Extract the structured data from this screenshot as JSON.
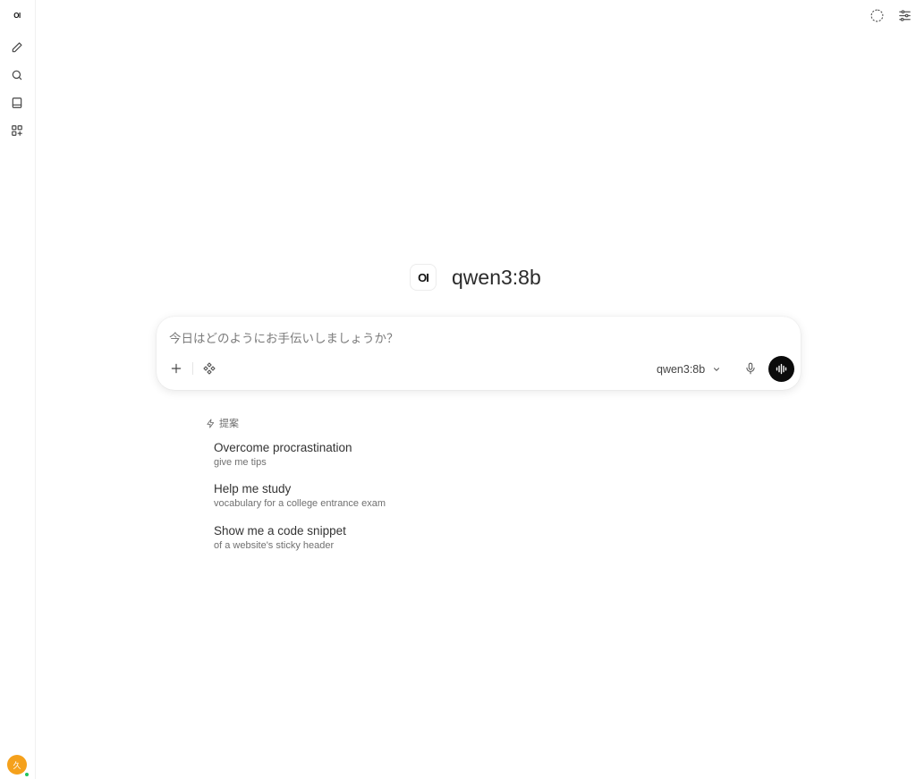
{
  "sidebar": {
    "logo": "OI",
    "items": [
      {
        "name": "new-chat",
        "icon": "pencil-icon"
      },
      {
        "name": "search",
        "icon": "search-icon"
      },
      {
        "name": "notes",
        "icon": "notebook-icon"
      },
      {
        "name": "workspace",
        "icon": "grid-plus-icon"
      }
    ],
    "user_avatar": "久"
  },
  "topbar": {
    "icons": [
      "temporary-chat-icon",
      "controls-icon"
    ]
  },
  "main": {
    "model_badge": "OI",
    "model_name": "qwen3:8b"
  },
  "input": {
    "placeholder": "今日はどのようにお手伝いしましょうか？",
    "value": "",
    "model_selector": "qwen3:8b"
  },
  "suggestions": {
    "header": "提案",
    "items": [
      {
        "title": "Overcome procrastination",
        "subtitle": "give me tips"
      },
      {
        "title": "Help me study",
        "subtitle": "vocabulary for a college entrance exam"
      },
      {
        "title": "Show me a code snippet",
        "subtitle": "of a website's sticky header"
      }
    ]
  },
  "colors": {
    "avatar": "#f5a11c",
    "online": "#22c55e",
    "voice_button": "#0b0b0b"
  }
}
